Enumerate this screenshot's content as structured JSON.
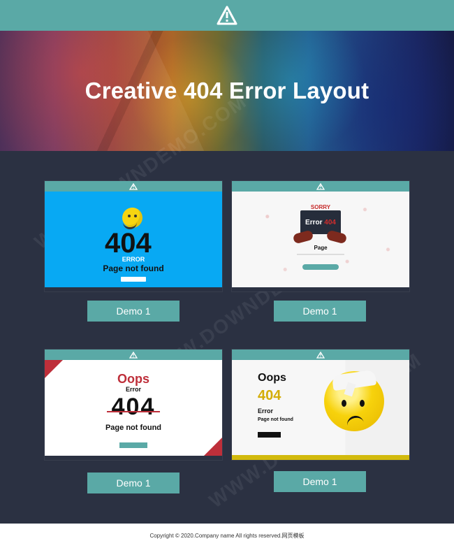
{
  "header": {
    "icon": "warning-icon",
    "title": "Creative 404 Error Layout"
  },
  "cards": [
    {
      "button": "Demo 1",
      "preview": {
        "code": "404",
        "label": "ERROR",
        "subtitle": "Page not found"
      }
    },
    {
      "button": "Demo 1",
      "preview": {
        "sorry": "SORRY",
        "error_word": "Error",
        "code": "404",
        "page": "Page"
      }
    },
    {
      "button": "Demo 1",
      "preview": {
        "oops": "Oops",
        "error": "Error",
        "code": "404",
        "subtitle": "Page not found"
      }
    },
    {
      "button": "Demo 1",
      "preview": {
        "oops": "Oops",
        "code": "404",
        "error": "Error",
        "subtitle": "Page not found"
      }
    }
  ],
  "footer": {
    "text": "Copyright © 2020.Company name All rights reserved.网页模板"
  }
}
